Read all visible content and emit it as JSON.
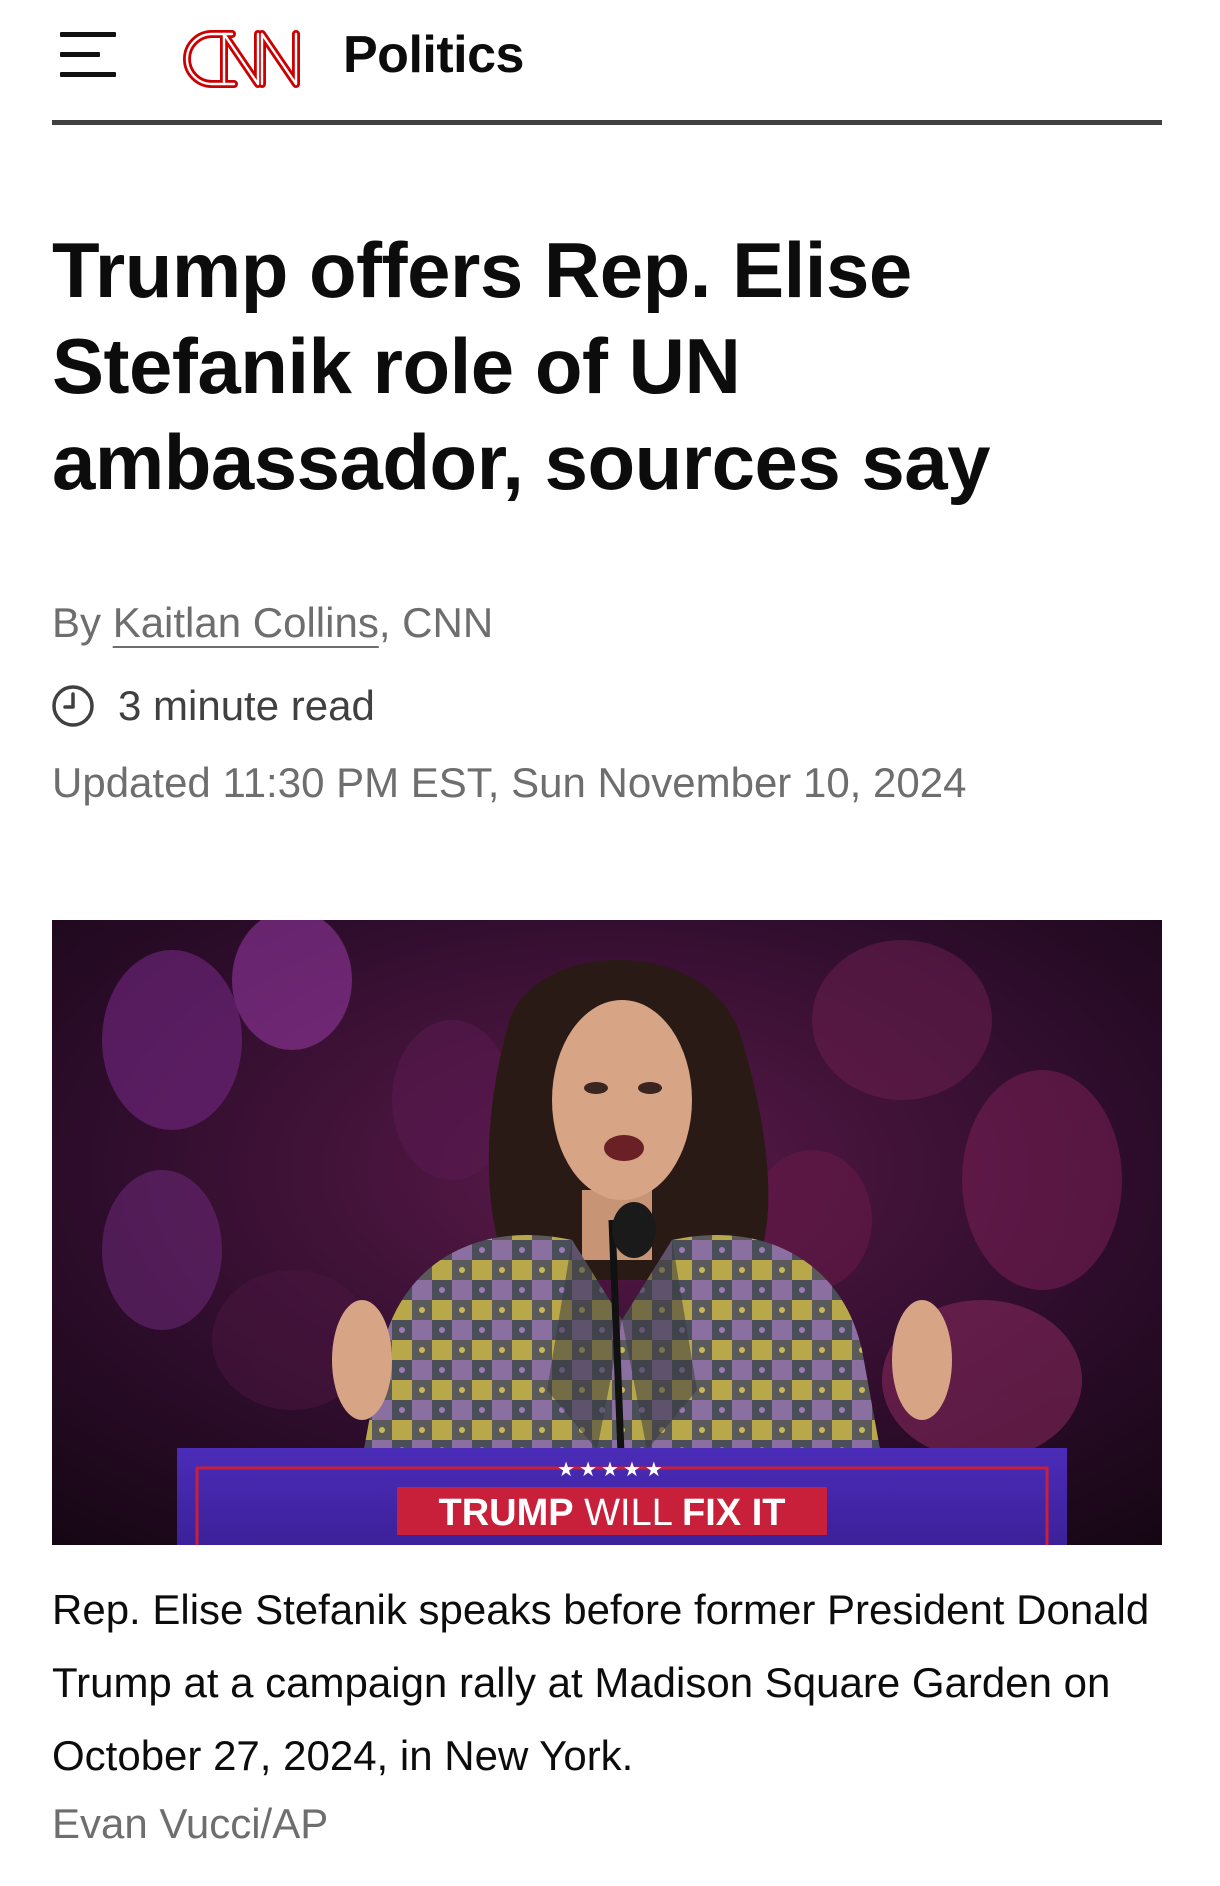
{
  "header": {
    "logo_text": "CNN",
    "section": "Politics",
    "menu_icon": "hamburger-menu-icon"
  },
  "article": {
    "headline": "Trump offers Rep. Elise Stefanik role of UN ambassador, sources say",
    "byline_prefix": "By ",
    "author": "Kaitlan Collins",
    "byline_suffix": ", CNN",
    "read_time": "3 minute read",
    "read_time_icon": "clock-icon",
    "updated": "Updated 11:30 PM EST, Sun November 10, 2024"
  },
  "image": {
    "podium_stars": "★★★★★",
    "podium_sign_bold_1": "TRUMP",
    "podium_sign_light": " WILL ",
    "podium_sign_bold_2": "FIX IT",
    "caption": "Rep. Elise Stefanik speaks before former President Donald Trump at a campaign rally at Madison Square Garden on October 27, 2024, in New York.",
    "credit": "Evan Vucci/AP"
  },
  "colors": {
    "brand_red": "#cc0000",
    "text": "#0c0c0c",
    "muted": "#6e6e6e",
    "rule": "#404040"
  }
}
